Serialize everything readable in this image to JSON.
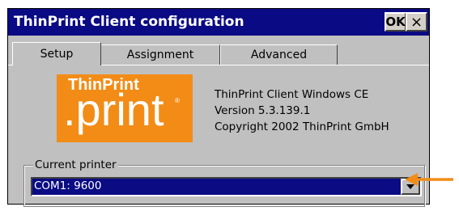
{
  "window": {
    "title": "ThinPrint Client configuration",
    "ok_label": "OK",
    "close_label": "×"
  },
  "tabs": [
    {
      "label": "Setup",
      "active": true
    },
    {
      "label": "Assignment",
      "active": false
    },
    {
      "label": "Advanced",
      "active": false
    }
  ],
  "logo": {
    "line1": "ThinPrint",
    "line2": ".print",
    "mark": "®"
  },
  "info": {
    "line1": "ThinPrint Client Windows CE",
    "line2": "Version  5.3.139.1",
    "line3": "Copyright 2002 ThinPrint GmbH"
  },
  "printer_group": {
    "label": "Current printer",
    "selected": "COM1: 9600"
  },
  "colors": {
    "titlebar": "#0a0a84",
    "dialog_bg": "#c0c0c0",
    "logo_orange": "#f28c16",
    "selection": "#0b0b84",
    "callout_arrow": "#f28c16"
  },
  "icons": {
    "dropdown": "triangle-down-icon",
    "callout": "arrow-left-icon"
  }
}
